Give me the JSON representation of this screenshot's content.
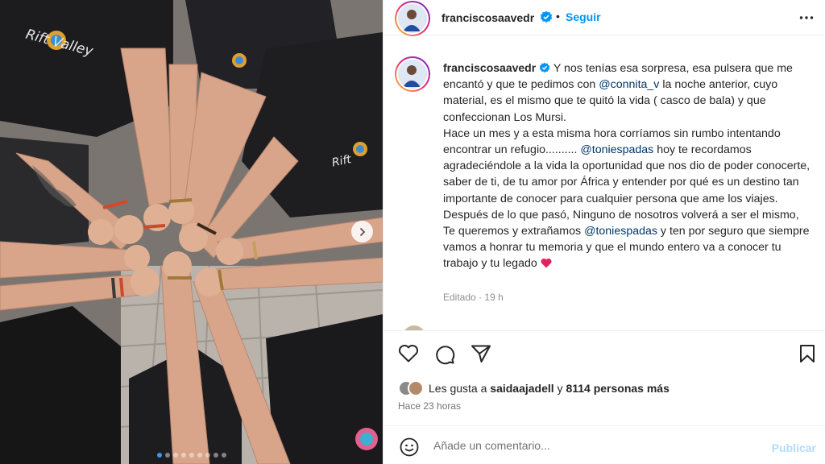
{
  "photo": {
    "alt_icons": {
      "next": "chevron-right-icon"
    },
    "carousel_dots": 9,
    "active_dot": 0,
    "shirt_text_1": "Rift Valley",
    "shirt_text_2": "Rift"
  },
  "header": {
    "username": "franciscosaavedr",
    "separator": "•",
    "follow_label": "Seguir",
    "more_icon": "more-horizontal-icon"
  },
  "caption": {
    "username": "franciscosaavedr",
    "parts": {
      "p1": " Y nos tenías esa sorpresa, esa pulsera que me encantó y que te pedimos con ",
      "m1": "@connita_v",
      "p2": " la noche anterior, cuyo material, es el mismo que te quitó la vida ( casco de bala) y que confeccionan Los Mursi.",
      "p3": "Hace un mes y a esta misma hora corríamos sin rumbo intentando encontrar un refugio.......... ",
      "m2": "@toniespadas",
      "p4": " hoy te recordamos agradeciéndole a la vida la oportunidad que nos dio de poder conocerte, saber de ti, de tu amor por África y entender por qué es un destino tan importante de conocer para cualquier persona que ame los viajes.",
      "p5": "Después de lo que pasó, Ninguno de nosotros volverá a ser el mismo, Te queremos y extrañamos ",
      "m3": "@toniespadas",
      "p6": " y ten por seguro que siempre vamos a honrar tu memoria y que el mundo entero va a conocer tu trabajo y tu legado ",
      "heart": "❤️"
    },
    "edited_label": "Editado",
    "edited_dot": "·",
    "edited_time": "19 h"
  },
  "actions": {
    "like_icon": "heart-outline-icon",
    "comment_icon": "comment-icon",
    "share_icon": "share-icon",
    "save_icon": "bookmark-icon"
  },
  "likes": {
    "prefix": "Les gusta a ",
    "user": "saidaajadell",
    "middle": " y ",
    "count": "8114 personas más"
  },
  "timestamp": "Hace 23 horas",
  "comment": {
    "placeholder": "Añade un comentario...",
    "publish_label": "Publicar",
    "emoji_icon": "emoji-icon"
  },
  "colors": {
    "link_blue": "#0095f6",
    "mention": "#00376b",
    "publish_disabled": "#b3dbff",
    "verified": "#0095f6",
    "heart": "#e0245e"
  }
}
